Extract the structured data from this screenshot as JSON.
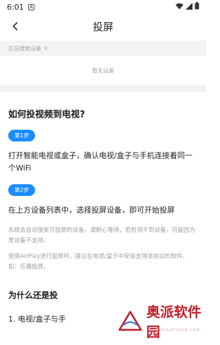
{
  "status_bar": {
    "time": "6:01",
    "icons": [
      "notification-icon",
      "wifi-icon",
      "signal-icon",
      "battery-icon"
    ]
  },
  "header": {
    "title": "投屏",
    "back_icon": "chevron-left-icon"
  },
  "search": {
    "status_text": "正在搜索设备",
    "spinner_icon": "spinner-icon"
  },
  "device_list": {
    "empty_text": "暂无设备"
  },
  "guide": {
    "title": "如何投视频到电视?",
    "steps": [
      {
        "badge": "第1步",
        "text": "打开智能电视或盒子，确认电视/盒子与手机连接着同一个WiFi"
      },
      {
        "badge": "第2步",
        "text": "在上方设备列表中，选择投屏设备，即可开始投屏"
      }
    ],
    "notes": [
      "系统会自动搜索可投屏的设备，请耐心等待。若检测不到设备，可能因为是设备不支持。",
      "使用AirPlay进行投屏时，建议在电视/盒子中安装支持该协议的软件，如：乐播投屏。"
    ]
  },
  "faq": {
    "title": "为什么还是投",
    "items": [
      "1. 电视/盒子与手"
    ]
  },
  "watermark": {
    "brand": "奥派软件园",
    "sub": "AOPAISOFTJOIN.COM",
    "accent": "#c21f2a"
  }
}
